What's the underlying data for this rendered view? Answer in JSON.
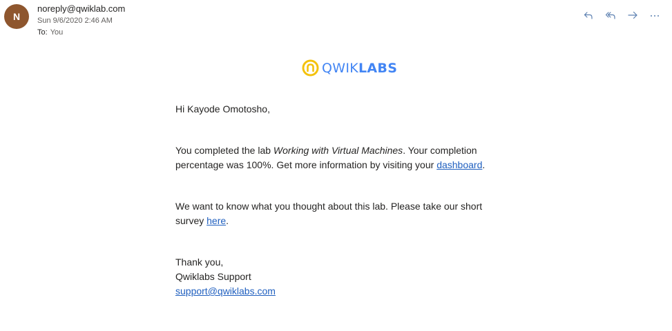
{
  "header": {
    "avatar_initial": "N",
    "avatar_color": "#8e562e",
    "sender": "noreply@qwiklab.com",
    "date": "Sun 9/6/2020 2:46 AM",
    "to_label": "To:",
    "to_value": "You"
  },
  "actions": [
    {
      "icon": "reply-icon"
    },
    {
      "icon": "reply-all-icon"
    },
    {
      "icon": "forward-icon"
    },
    {
      "icon": "more-icon"
    }
  ],
  "logo": {
    "text_light": "QWIK",
    "text_bold": "LABS",
    "brand_color": "#4285f4",
    "mark_color": "#f4c20d"
  },
  "email": {
    "greeting": "Hi Kayode Omotosho,",
    "p1_before": "You completed the lab ",
    "p1_lab": "Working with Virtual Machines",
    "p1_after": ". Your completion percentage was 100%. Get more information by visiting your ",
    "p1_link": "dashboard",
    "p1_end": ".",
    "p2_before": "We want to know what you thought about this lab. Please take our short survey ",
    "p2_link": "here",
    "p2_end": ".",
    "signoff": "Thank you,",
    "signature": "Qwiklabs Support",
    "support_email": "support@qwiklabs.com"
  }
}
